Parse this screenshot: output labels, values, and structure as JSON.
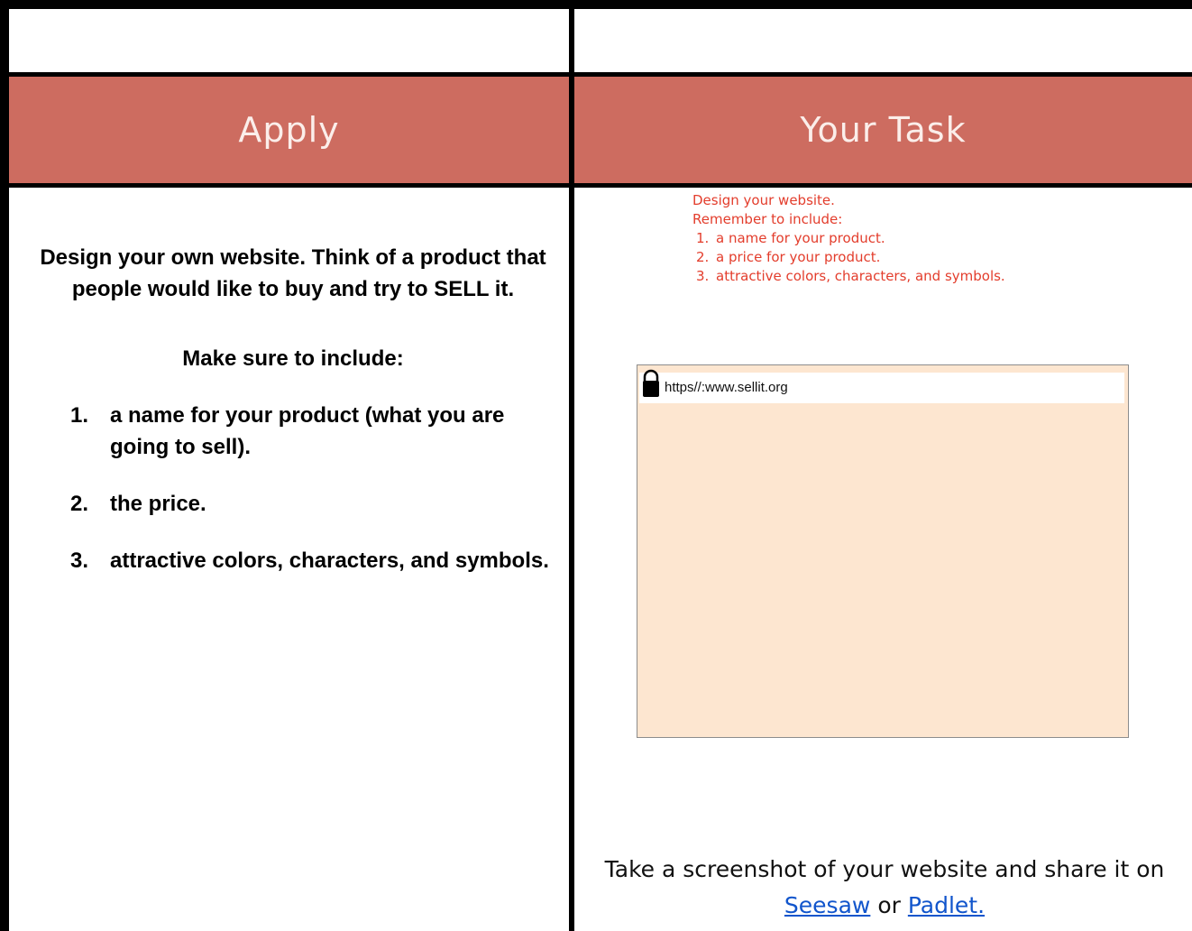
{
  "header": {
    "left_title": "Apply",
    "right_title": "Your Task"
  },
  "left": {
    "intro": "Design your own website.  Think of a product that people would like to buy and try to SELL it.",
    "include_heading": "Make sure to include:",
    "items": [
      {
        "num": "1.",
        "text": "a name for your product (what you are going to sell)."
      },
      {
        "num": "2.",
        "text": "the price."
      },
      {
        "num": "3.",
        "text": "attractive colors, characters, and symbols."
      }
    ]
  },
  "right": {
    "instructions": {
      "line1": "Design your website.",
      "line2": "Remember to include:",
      "items": [
        {
          "num": "1.",
          "text": "a name for your product."
        },
        {
          "num": "2.",
          "text": "a price for your product."
        },
        {
          "num": "3.",
          "text": "attractive colors, characters, and symbols."
        }
      ]
    },
    "mockup": {
      "url": "https//:www.sellit.org"
    },
    "footer": {
      "text_before": "Take a screenshot of your website and share it on",
      "link1": "Seesaw",
      "or": "or",
      "link2": "Padlet."
    }
  },
  "colors": {
    "header_bg": "#cd6c60",
    "header_text": "#fbeeea",
    "instruction_text": "#e33d2c",
    "mockup_bg": "#fde6d0",
    "link": "#1155cc"
  }
}
